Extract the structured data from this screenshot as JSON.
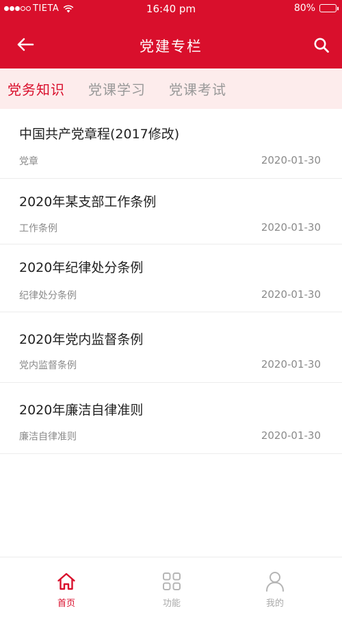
{
  "status_bar": {
    "carrier": "TIETA",
    "time": "16:40 pm",
    "battery": "80%",
    "battery_level": 0.8,
    "signal_bars": 3,
    "signal_total": 5
  },
  "header": {
    "title": "党建专栏",
    "back_icon": "arrow-left-icon",
    "search_icon": "search-icon",
    "bg_color": "#d90f2c"
  },
  "tabs": [
    {
      "label": "党务知识",
      "active": true
    },
    {
      "label": "党课学习",
      "active": false
    },
    {
      "label": "党课考试",
      "active": false
    }
  ],
  "articles": [
    {
      "title": "中国共产党章程(2017修改)",
      "category": "党章",
      "date": "2020-01-30"
    },
    {
      "title": "2020年某支部工作条例",
      "category": "工作条例",
      "date": "2020-01-30"
    },
    {
      "title": "2020年纪律处分条例",
      "category": "纪律处分条例",
      "date": "2020-01-30"
    },
    {
      "title": "2020年党内监督条例",
      "category": "党内监督条例",
      "date": "2020-01-30"
    },
    {
      "title": "2020年廉洁自律准则",
      "category": "廉洁自律准则",
      "date": "2020-01-30"
    }
  ],
  "bottom_nav": [
    {
      "label": "首页",
      "icon": "home-icon",
      "active": true
    },
    {
      "label": "功能",
      "icon": "grid-icon",
      "active": false
    },
    {
      "label": "我的",
      "icon": "user-icon",
      "active": false
    }
  ],
  "colors": {
    "accent": "#d90f2c",
    "tab_bar_bg": "#fdecec",
    "muted_text": "#8a8a8a"
  }
}
